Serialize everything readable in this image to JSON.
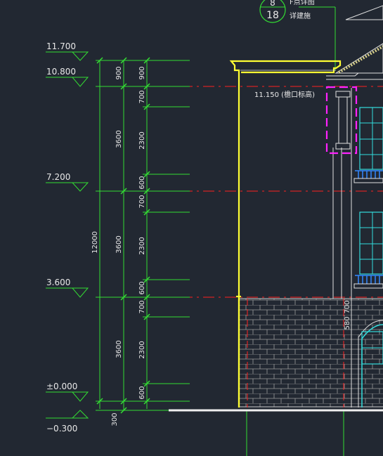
{
  "detail_marker": {
    "top_number": "8",
    "sheet_number": "18",
    "note_line1": "F点详图",
    "note_line2": "详建施"
  },
  "eave_note": "11.150 (檐口标高)",
  "level_marks": [
    "11.700",
    "10.800",
    "7.200",
    "3.600",
    "±0.000",
    "−0.300"
  ],
  "total_height": "12000",
  "storey_dims": [
    "900",
    "3600",
    "3600",
    "3600",
    "300"
  ],
  "detail_dims": [
    "900",
    "700",
    "2300",
    "600",
    "700",
    "2300",
    "600",
    "700",
    "2300",
    "600"
  ],
  "side_dims": [
    "580",
    "700"
  ],
  "colors": {
    "background": "#222832",
    "dimension_green": "#33dd33",
    "outline_yellow": "#ffff33",
    "axis_red": "#ff2020",
    "detail_magenta": "#ff22ff",
    "window_cyan": "#33dddd",
    "railing_blue": "#3388ff",
    "brick_gray": "#9a9a9a"
  }
}
